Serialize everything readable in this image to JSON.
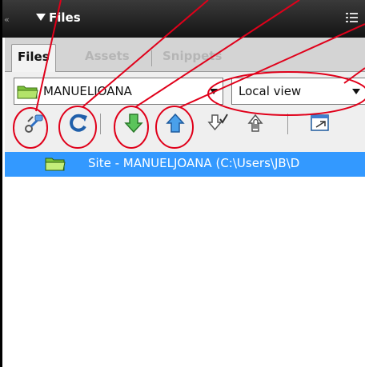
{
  "panel": {
    "title": "Files",
    "tabs": [
      {
        "label": "Files"
      },
      {
        "label": "Assets"
      },
      {
        "label": "Snippets"
      }
    ]
  },
  "toolbar": {
    "site_select_value": "MANUELJOANA",
    "view_select_value": "Local view",
    "tools": [
      "connect-icon",
      "refresh-icon",
      "get-files-icon",
      "put-files-icon",
      "check-out-icon",
      "check-in-icon",
      "expand-panel-icon"
    ]
  },
  "file_list": {
    "rows": [
      {
        "label": "Site - MANUELJOANA (C:\\Users\\JB\\D"
      }
    ]
  },
  "colors": {
    "titlebar": "#1e1e1e",
    "selection": "#3399ff",
    "annotation": "#e0001a",
    "folder": "#8fcf3a",
    "get_arrow": "#3aa53a",
    "put_arrow": "#2f86d6",
    "refresh": "#1f5faa"
  }
}
